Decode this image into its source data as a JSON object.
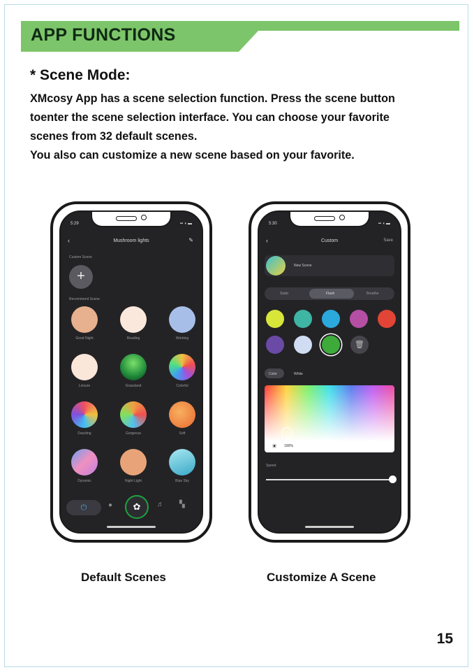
{
  "header": {
    "title": "APP FUNCTIONS",
    "accent": "#7dc56a"
  },
  "section": {
    "title": "* Scene Mode:",
    "lines": [
      "XMcosy App has a scene selection function. Press the scene button",
      "toenter the scene selection interface. You can choose your favorite",
      "scenes from 32 default scenes.",
      "You also can customize a new scene based on your favorite."
    ]
  },
  "left_phone": {
    "time": "5:29",
    "title": "Mushroom lights",
    "custom_label": "Custom Scene",
    "add_icon": "plus-icon",
    "recommend_label": "Recommend Scene",
    "scenes": [
      {
        "name": "Good Night",
        "color": "#e7b08e"
      },
      {
        "name": "Reading",
        "color": "#fbe8dc"
      },
      {
        "name": "Working",
        "color": "#a7bfe8"
      },
      {
        "name": "Leisure",
        "color": "#fbe6da"
      },
      {
        "name": "Grassland",
        "color": "#1f9b45"
      },
      {
        "name": "Colorful",
        "color": "#f07050"
      },
      {
        "name": "Dazzling",
        "color": "#e0505a"
      },
      {
        "name": "Gorgeous",
        "color": "#f0a040"
      },
      {
        "name": "Soft",
        "color": "#ee9548"
      },
      {
        "name": "Dynamic",
        "color": "#c890d8"
      },
      {
        "name": "Night Light",
        "color": "#e8a478"
      },
      {
        "name": "Blue Sky",
        "color": "#62c2da"
      }
    ],
    "tab_icons": [
      "power-icon",
      "bulb-icon",
      "palette-icon",
      "music-icon",
      "grid-icon"
    ]
  },
  "right_phone": {
    "time": "5:30",
    "title": "Custom",
    "save_label": "Save",
    "scene_name": "New Scene",
    "modes": [
      "Static",
      "Flash",
      "Breathe"
    ],
    "swatches": [
      "#d8e63a",
      "#3fb5a4",
      "#2ba9dc",
      "#b44fa4",
      "#e24535",
      "#6b4aa6",
      "#cfdcf2",
      "#3daa3a"
    ],
    "color_tab": "Color",
    "white_tab": "White",
    "brightness": "100%",
    "speed_label": "Speed"
  },
  "captions": {
    "left": "Default Scenes",
    "right": "Customize A Scene"
  },
  "page_number": "15"
}
